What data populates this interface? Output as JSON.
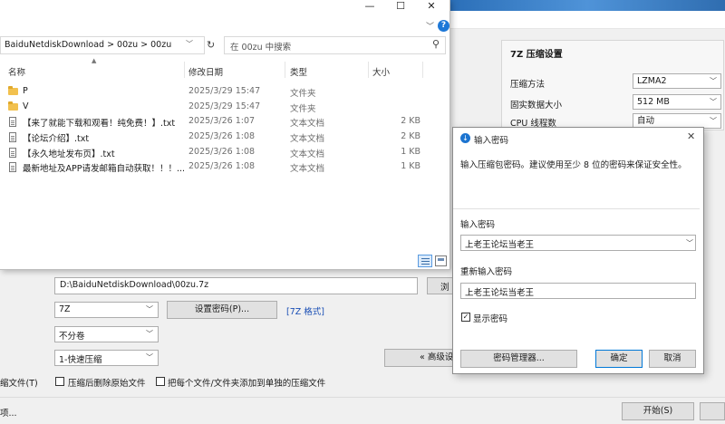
{
  "explorer": {
    "breadcrumb": "BaiduNetdiskDownload  >  00zu  >  00zu",
    "search_placeholder": "在 00zu 中搜索",
    "columns": {
      "name": "名称",
      "date": "修改日期",
      "type": "类型",
      "size": "大小"
    },
    "rows": [
      {
        "kind": "folder",
        "name": "P",
        "date": "2025/3/29 15:47",
        "type": "文件夹",
        "size": ""
      },
      {
        "kind": "folder",
        "name": "V",
        "date": "2025/3/29 15:47",
        "type": "文件夹",
        "size": ""
      },
      {
        "kind": "file",
        "name": "【来了就能下载和观看！纯免费！】.txt",
        "date": "2025/3/26 1:07",
        "type": "文本文档",
        "size": "2 KB"
      },
      {
        "kind": "file",
        "name": "【论坛介绍】.txt",
        "date": "2025/3/26 1:08",
        "type": "文本文档",
        "size": "2 KB"
      },
      {
        "kind": "file",
        "name": "【永久地址发布页】.txt",
        "date": "2025/3/26 1:08",
        "type": "文本文档",
        "size": "1 KB"
      },
      {
        "kind": "file",
        "name": "最新地址及APP请发邮箱自动获取！！！...",
        "date": "2025/3/26 1:08",
        "type": "文本文档",
        "size": "1 KB"
      }
    ]
  },
  "archive": {
    "settings_title": "7Z 压缩设置",
    "method_label": "压缩方法",
    "method_value": "LZMA2",
    "dict_label": "固实数据大小",
    "dict_value": "512 MB",
    "cpu_label": "CPU 线程数",
    "cpu_value": "自动",
    "path_value": "D:\\BaiduNetdiskDownload\\00zu.7z",
    "browse_label": "浏",
    "format_value": "7Z",
    "set_password_label": "设置密码(P)...",
    "format_link": "[7Z 格式]",
    "split_value": "不分卷",
    "level_value": "1-快速压缩",
    "advanced_label": "« 高级设",
    "cb_partial_label": "缩文件(T)",
    "cb_delete_label": "压缩后删除原始文件",
    "cb_separate_label": "把每个文件/文件夹添加到单独的压缩文件",
    "start_label": "开始(S)",
    "bottom_left": "项..."
  },
  "dialog": {
    "title": "输入密码",
    "description": "输入压缩包密码。建议使用至少 8 位的密码来保证安全性。",
    "password_label": "输入密码",
    "password_value": "上老王论坛当老王",
    "repeat_label": "重新输入密码",
    "repeat_value": "上老王论坛当老王",
    "show_password_label": "显示密码",
    "show_password_checked": true,
    "manager_label": "密码管理器...",
    "ok_label": "确定",
    "cancel_label": "取消"
  }
}
